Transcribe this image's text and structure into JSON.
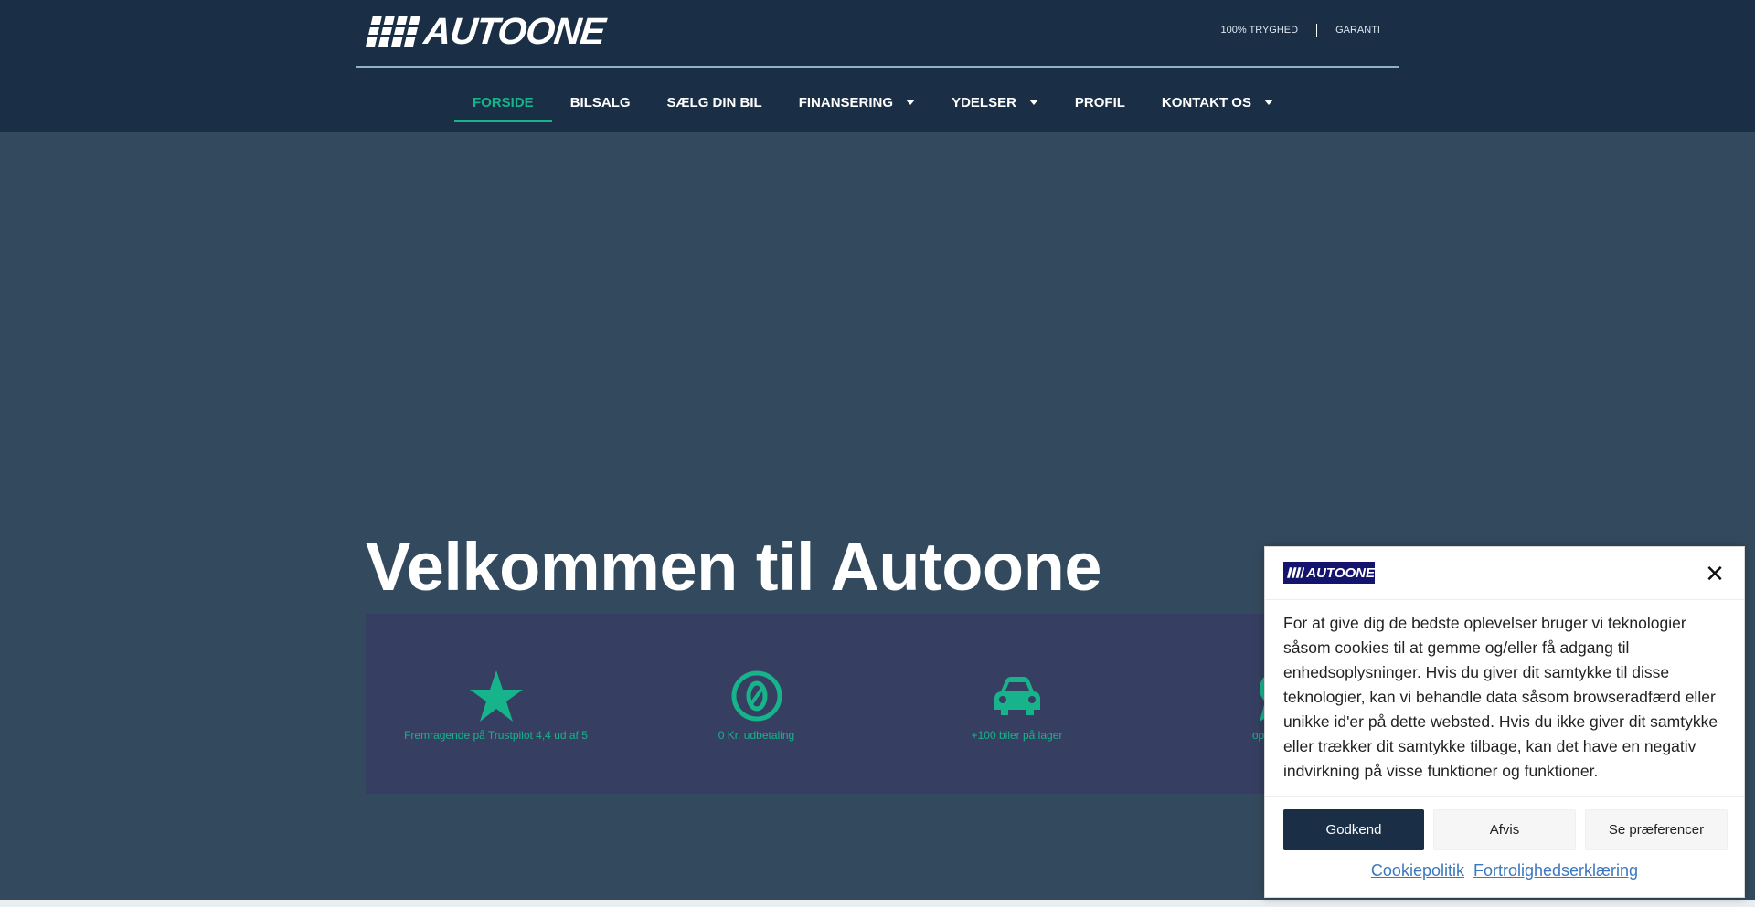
{
  "brand": {
    "name": "AUTOONE"
  },
  "toplinks": [
    {
      "label": "100% TRYGHED"
    },
    {
      "label": "GARANTI"
    }
  ],
  "nav": [
    {
      "label": "FORSIDE"
    },
    {
      "label": "BILSALG"
    },
    {
      "label": "SÆLG DIN BIL"
    },
    {
      "label": "FINANSERING"
    },
    {
      "label": "YDELSER"
    },
    {
      "label": "PROFIL"
    },
    {
      "label": "KONTAKT OS"
    }
  ],
  "hero": {
    "title": "Velkommen til Autoone"
  },
  "features": [
    {
      "icon": "star-icon",
      "label": "Fremragende på Trustpilot 4,4 ud af 5"
    },
    {
      "icon": "zero-icon",
      "label": "0 Kr. udbetaling"
    },
    {
      "icon": "car-icon",
      "label": "+100 biler på lager"
    },
    {
      "icon": "award-icon",
      "label": "op til 36 m"
    }
  ],
  "cookie": {
    "logo_text": "AUTOONE",
    "body": "For at give dig de bedste oplevelser bruger vi teknologier såsom cookies til at gemme og/eller få adgang til enhedsoplysninger. Hvis du giver dit samtykke til disse teknologier, kan vi behandle data såsom browseradfærd eller unikke id'er på dette websted. Hvis du ikke giver dit samtykke eller trækker dit samtykke tilbage, kan det have en negativ indvirkning på visse funktioner og funktioner.",
    "accept_label": "Godkend",
    "deny_label": "Afvis",
    "prefs_label": "Se præferencer",
    "links": [
      {
        "label": "Cookiepolitik"
      },
      {
        "label": "Fortrolighedserklæring"
      }
    ]
  },
  "colors": {
    "header": "#1a2e45",
    "accent": "#17b38a",
    "hero_bg": "#334a5e",
    "features_bg": "#363f61"
  }
}
